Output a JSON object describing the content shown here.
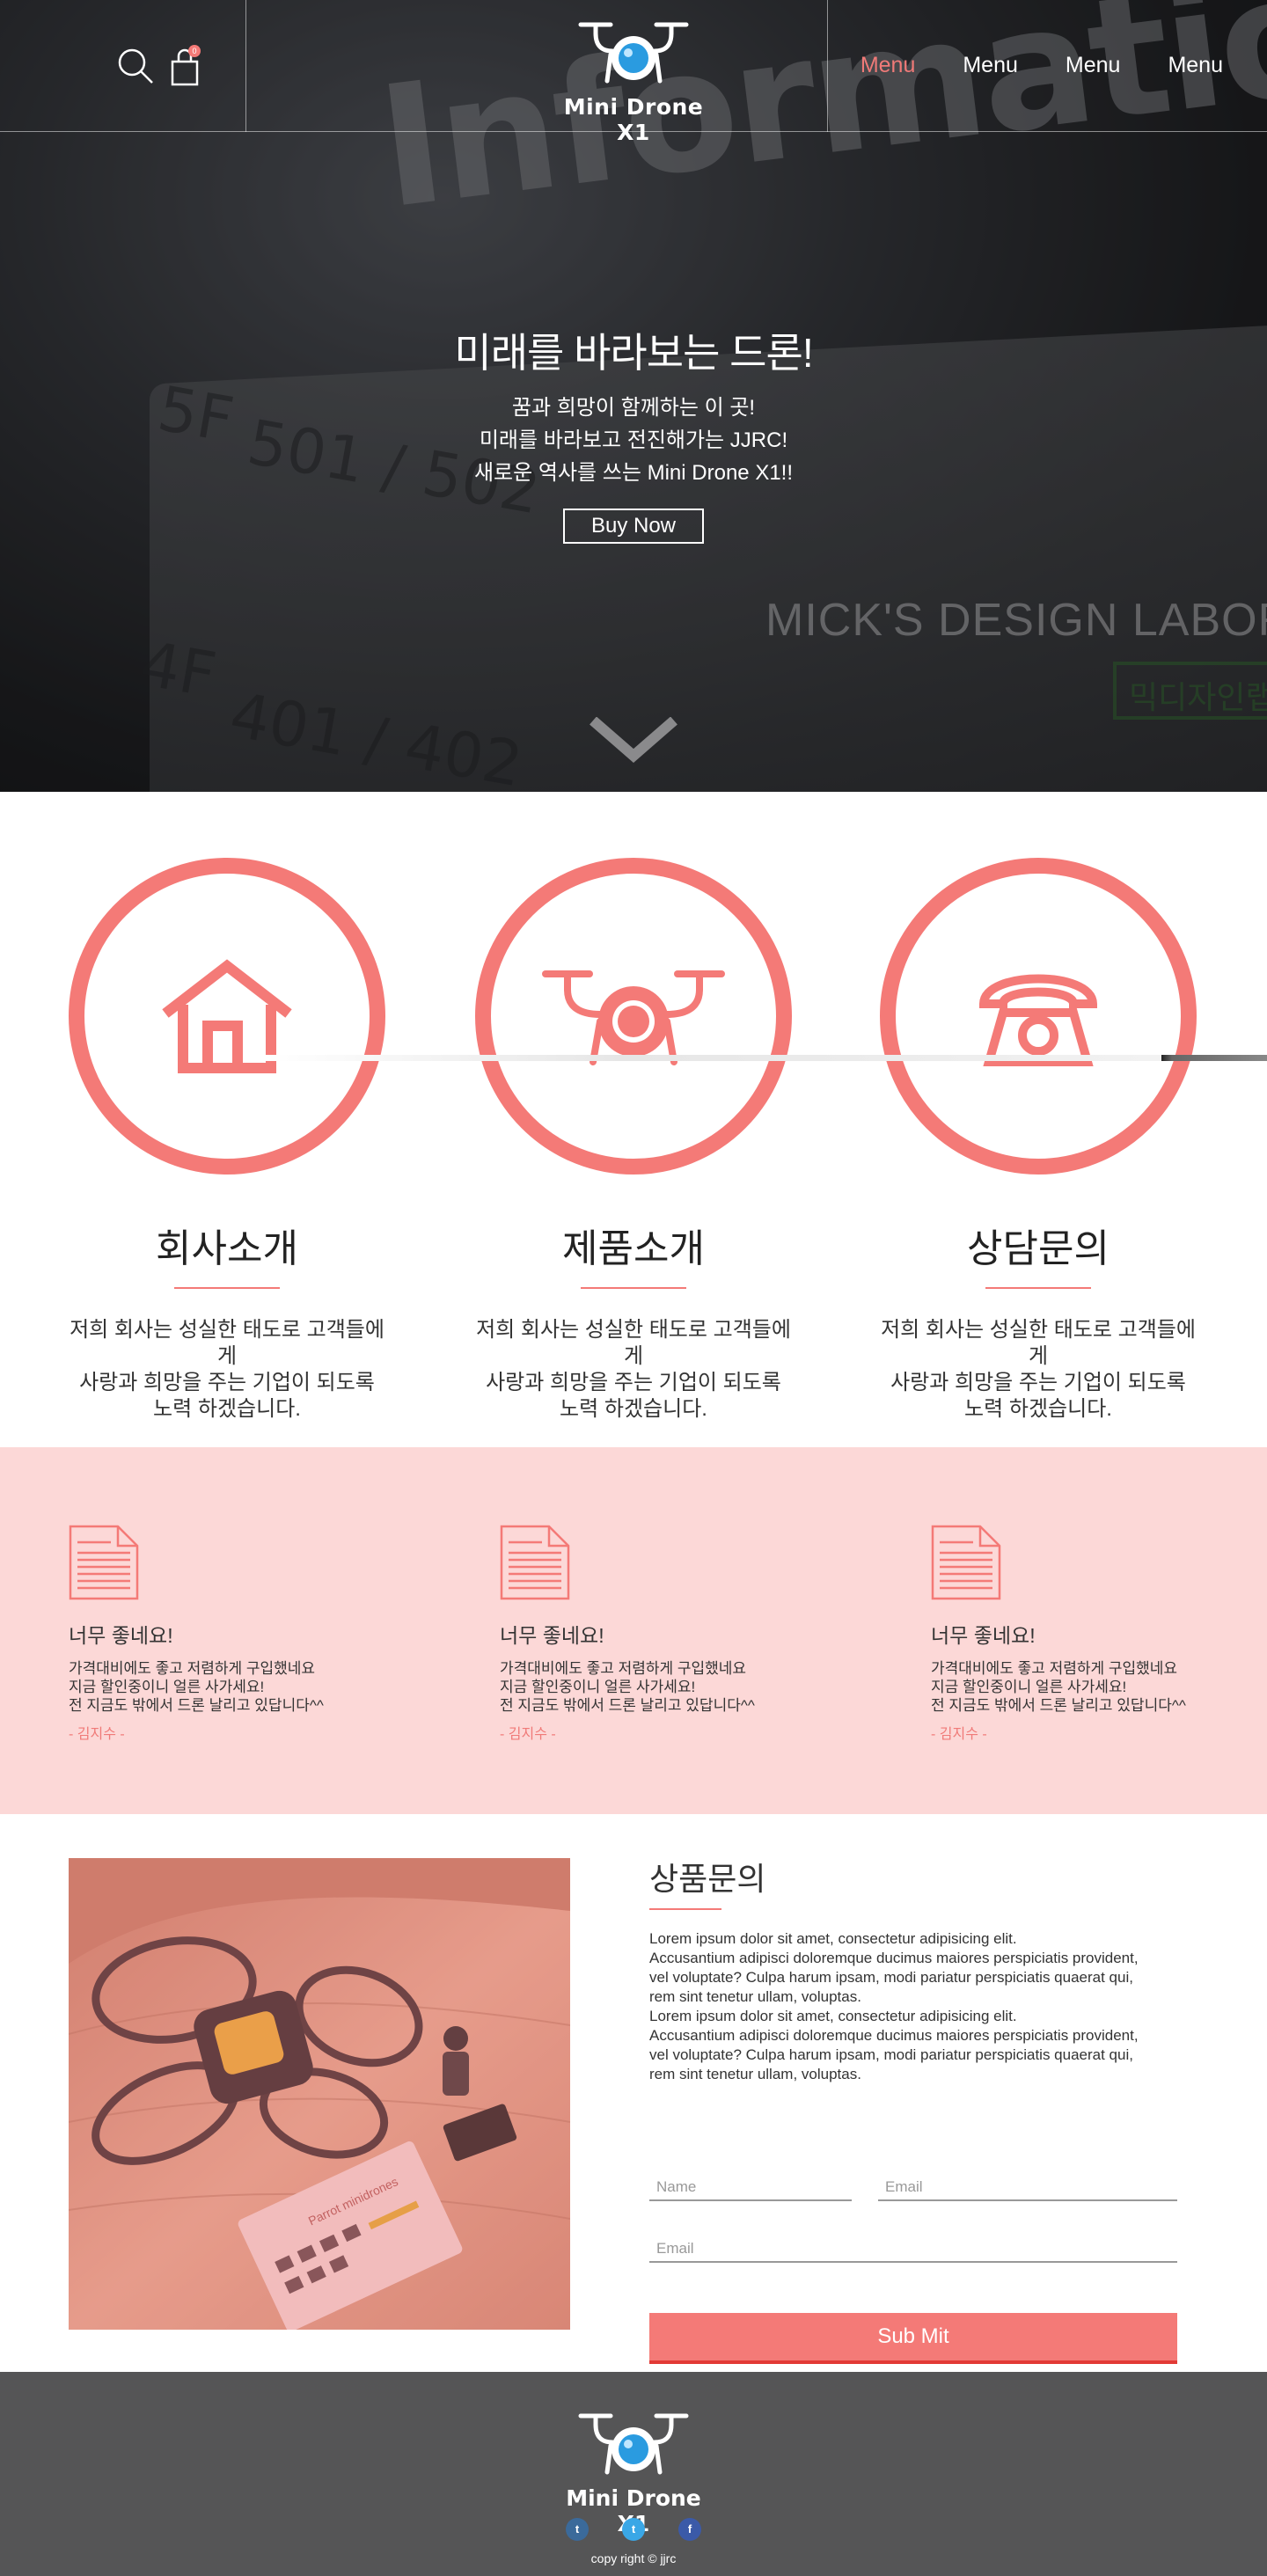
{
  "header": {
    "logo_text": "Mini Drone X1",
    "cart_count": "0",
    "nav": [
      "Menu",
      "Menu",
      "Menu",
      "Menu"
    ],
    "active_nav_index": 0
  },
  "hero": {
    "bg_sign": "Information",
    "bg_floor_1": "5F",
    "bg_floor_2": "501 / 502",
    "bg_floor_3": "4F",
    "bg_floor_4": "401 / 402",
    "bg_lab": "MICK'S DESIGN LABORA",
    "bg_box": "믹디자인랩",
    "title": "미래를 바라보는 드론!",
    "lines": [
      "꿈과 희망이 함께하는 이 곳!",
      "미래를 바라보고 전진해가는 JJRC!",
      "새로운 역사를 쓰는 Mini Drone X1!!"
    ],
    "cta": "Buy Now"
  },
  "services": [
    {
      "icon": "house-icon",
      "title": "회사소개",
      "desc": [
        "저희 회사는 성실한 태도로 고객들에게",
        "사랑과 희망을 주는 기업이 되도록",
        "노력 하겠습니다."
      ]
    },
    {
      "icon": "drone-icon",
      "title": "제품소개",
      "desc": [
        "저희 회사는 성실한 태도로 고객들에게",
        "사랑과 희망을 주는 기업이 되도록",
        "노력 하겠습니다."
      ]
    },
    {
      "icon": "telephone-icon",
      "title": "상담문의",
      "desc": [
        "저희 회사는 성실한 태도로 고객들에게",
        "사랑과 희망을 주는 기업이 되도록",
        "노력 하겠습니다."
      ]
    }
  ],
  "testimonials": [
    {
      "title": "너무 좋네요!",
      "lines": [
        "가격대비에도 좋고 저렴하게 구입했네요",
        "지금 할인중이니 얼른 사가세요!",
        "전 지금도 밖에서 드론 날리고 있답니다^^"
      ],
      "author": "- 김지수 -"
    },
    {
      "title": "너무 좋네요!",
      "lines": [
        "가격대비에도 좋고 저렴하게 구입했네요",
        "지금 할인중이니 얼른 사가세요!",
        "전 지금도 밖에서 드론 날리고 있답니다^^"
      ],
      "author": "- 김지수 -"
    },
    {
      "title": "너무 좋네요!",
      "lines": [
        "가격대비에도 좋고 저렴하게 구입했네요",
        "지금 할인중이니 얼른 사가세요!",
        "전 지금도 밖에서 드론 날리고 있답니다^^"
      ],
      "author": "- 김지수 -"
    }
  ],
  "inquiry": {
    "title": "상품문의",
    "photo_card_text": "Parrot minidrones",
    "paragraphs": [
      "Lorem ipsum dolor sit amet, consectetur adipisicing elit.",
      "Accusantium adipisci doloremque ducimus maiores perspiciatis provident,",
      "vel voluptate? Culpa harum ipsam, modi pariatur perspiciatis quaerat qui,",
      "rem sint tenetur ullam, voluptas.",
      "Lorem ipsum dolor sit amet, consectetur adipisicing elit.",
      "Accusantium adipisci doloremque ducimus maiores perspiciatis provident,",
      "vel voluptate? Culpa harum ipsam, modi pariatur perspiciatis quaerat qui,",
      "rem sint tenetur ullam, voluptas."
    ],
    "name_placeholder": "Name",
    "email_placeholder": "Email",
    "email2_placeholder": "Email",
    "submit_label": "Sub Mit"
  },
  "footer": {
    "logo_text": "Mini Drone X1",
    "socials": [
      {
        "icon": "tumblr-icon",
        "glyph": "t"
      },
      {
        "icon": "twitter-icon",
        "glyph": "t"
      },
      {
        "icon": "facebook-icon",
        "glyph": "f"
      }
    ],
    "copyright": "copy right © jjrc"
  },
  "colors": {
    "accent": "#f47a77",
    "testimonial_bg": "#fcd8d7",
    "footer_bg": "#555556",
    "submit_border": "#e23a36"
  }
}
